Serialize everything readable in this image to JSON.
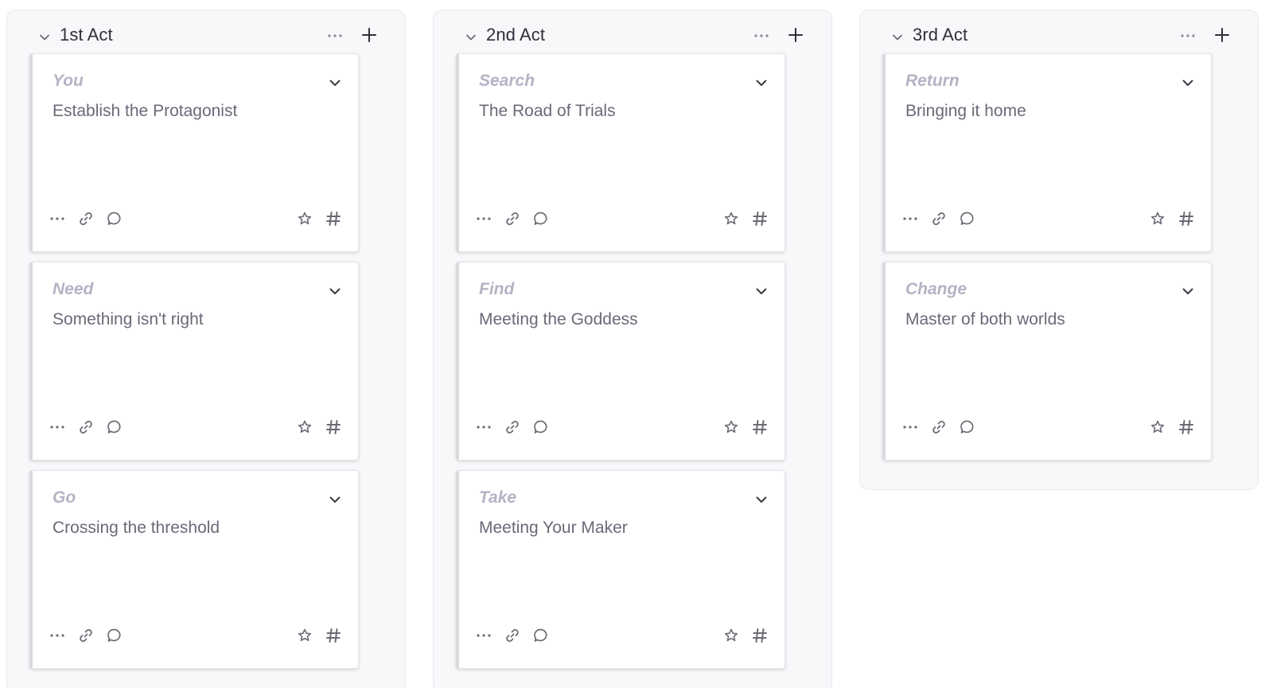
{
  "board": {
    "columns": [
      {
        "title": "1st Act",
        "icons": {
          "collapse": "chevron-down-icon",
          "more": "more-horizontal-icon",
          "add": "plus-icon"
        },
        "cards": [
          {
            "label": "You",
            "title": "Establish the Protagonist"
          },
          {
            "label": "Need",
            "title": "Something isn't right"
          },
          {
            "label": "Go",
            "title": "Crossing the threshold"
          }
        ]
      },
      {
        "title": "2nd Act",
        "icons": {
          "collapse": "chevron-down-icon",
          "more": "more-horizontal-icon",
          "add": "plus-icon"
        },
        "cards": [
          {
            "label": "Search",
            "title": "The Road of Trials"
          },
          {
            "label": "Find",
            "title": "Meeting the Goddess"
          },
          {
            "label": "Take",
            "title": "Meeting Your Maker"
          }
        ]
      },
      {
        "title": "3rd Act",
        "icons": {
          "collapse": "chevron-down-icon",
          "more": "more-horizontal-icon",
          "add": "plus-icon"
        },
        "cards": [
          {
            "label": "Return",
            "title": "Bringing it home"
          },
          {
            "label": "Change",
            "title": "Master of both worlds"
          }
        ]
      }
    ],
    "card_icons": [
      "more-horizontal-icon",
      "link-icon",
      "comment-icon",
      "star-icon",
      "hash-icon"
    ]
  },
  "colors": {
    "column_bg": "#f7f8fa",
    "card_bg": "#ffffff",
    "card_label": "#b3b3c4",
    "card_title": "#6a6a78",
    "column_title": "#2f2f3a",
    "icon": "#6b6b76"
  }
}
